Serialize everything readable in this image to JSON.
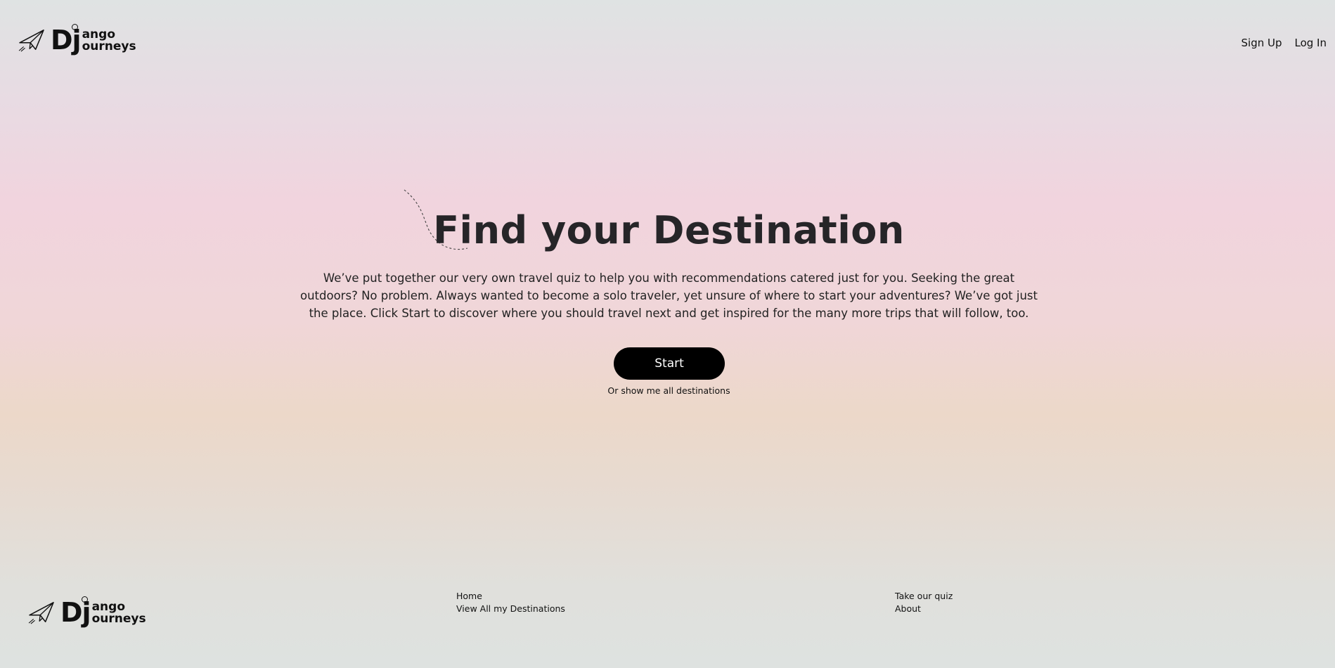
{
  "brand": {
    "logo_dj": "Dj",
    "logo_line1": "ango",
    "logo_line2": "ourneys"
  },
  "nav": {
    "signup": "Sign Up",
    "login": "Log In"
  },
  "hero": {
    "title": "Find your Destination",
    "description": "We’ve put together our very own travel quiz to help you with recommendations catered just for you. Seeking the great outdoors? No problem. Always wanted to become a solo traveler, yet unsure of where to start your adventures? We’ve got just the place. Click Start to discover where you should travel next and get inspired for the many more trips that will follow, too.",
    "start_label": "Start",
    "all_destinations_link": "Or show me all destinations"
  },
  "footer": {
    "col1": [
      "Home",
      "View All my Destinations"
    ],
    "col2": [
      "Take our quiz",
      "About"
    ]
  },
  "icons": {
    "plane": "paper-plane-icon",
    "globe": "globe-icon"
  },
  "colors": {
    "button_bg": "#000000",
    "button_text": "#ffffff",
    "title": "#262528"
  }
}
